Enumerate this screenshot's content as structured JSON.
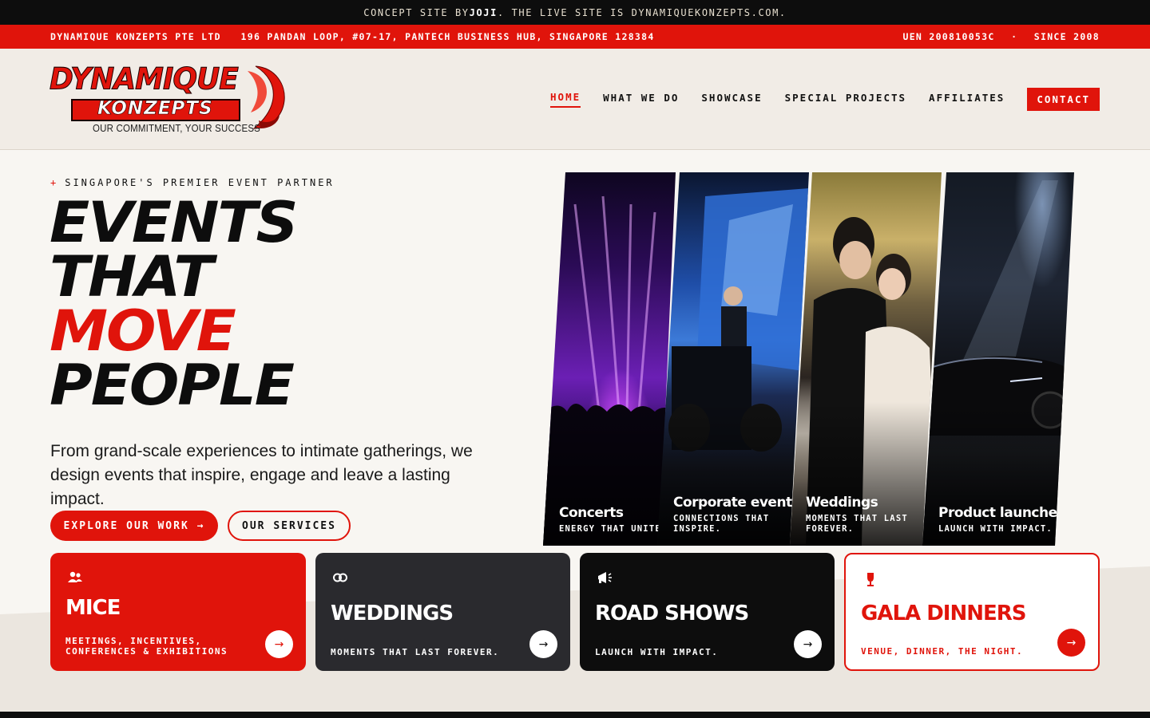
{
  "announce": {
    "prefix": "CONCEPT SITE BY ",
    "author": "JOJI",
    "suffix": ". THE LIVE SITE IS DYNAMIQUEKONZEPTS.COM."
  },
  "infobar": {
    "company": "DYNAMIQUE KONZEPTS PTE LTD",
    "address": "196 PANDAN LOOP, #07-17, PANTECH BUSINESS HUB, SINGAPORE 128384",
    "uen": "UEN 200810053C",
    "sep": "·",
    "since": "SINCE 2008"
  },
  "logo": {
    "line1": "DYNAMIQUE",
    "line2": "KONZEPTS",
    "tagline": "OUR COMMITMENT, YOUR SUCCESS"
  },
  "nav": {
    "items": [
      {
        "label": "HOME",
        "active": true
      },
      {
        "label": "WHAT WE DO"
      },
      {
        "label": "SHOWCASE"
      },
      {
        "label": "SPECIAL PROJECTS"
      },
      {
        "label": "AFFILIATES"
      }
    ],
    "contact": "CONTACT"
  },
  "hero": {
    "kicker_symbol": "+",
    "kicker": "SINGAPORE'S PREMIER EVENT PARTNER",
    "headline": [
      "EVENTS",
      "THAT",
      "MOVE",
      "PEOPLE"
    ],
    "subtitle": "From grand-scale experiences to intimate gatherings, we design events that inspire, engage and leave a lasting impact.",
    "primary_button": "EXPLORE OUR WORK →",
    "secondary_button": "OUR SERVICES"
  },
  "panels": [
    {
      "title": "Concerts",
      "desc": "ENERGY THAT UNITES."
    },
    {
      "title": "Corporate events",
      "desc": "CONNECTIONS THAT INSPIRE."
    },
    {
      "title": "Weddings",
      "desc": "MOMENTS THAT LAST FOREVER."
    },
    {
      "title": "Product launches",
      "desc": "LAUNCH WITH IMPACT."
    }
  ],
  "cards": [
    {
      "title": "MICE",
      "desc": "MEETINGS, INCENTIVES, CONFERENCES & EXHIBITIONS",
      "icon": "people-icon",
      "arrow": "→"
    },
    {
      "title": "WEDDINGS",
      "desc": "MOMENTS THAT LAST FOREVER.",
      "icon": "rings-icon",
      "arrow": "→"
    },
    {
      "title": "ROAD SHOWS",
      "desc": "LAUNCH WITH IMPACT.",
      "icon": "megaphone-icon",
      "arrow": "→"
    },
    {
      "title": "GALA DINNERS",
      "desc": "VENUE, DINNER, THE NIGHT.",
      "icon": "wine-glass-icon",
      "arrow": "→"
    }
  ],
  "colors": {
    "brand_red": "#e0140b",
    "dark": "#0d0d0d",
    "cream": "#f8f6f2"
  }
}
